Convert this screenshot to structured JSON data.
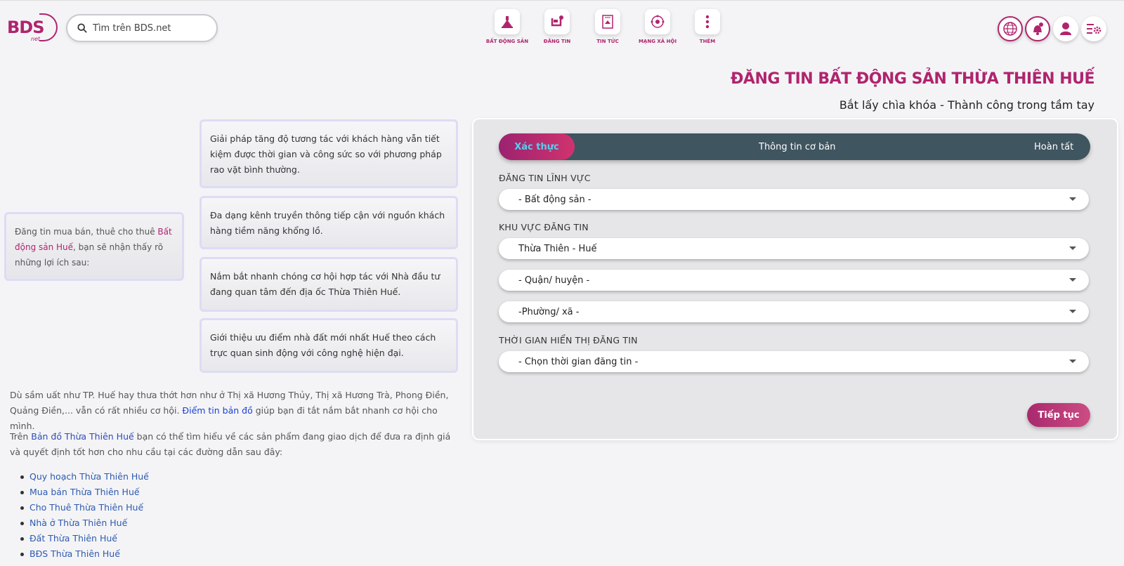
{
  "brand": {
    "logo_text": "BDS",
    "logo_sub": "net",
    "accent": "#b0246e"
  },
  "search": {
    "placeholder": "Tìm trên BDS.net"
  },
  "nav": [
    {
      "label": "BẤT ĐỘNG SẢN",
      "icon": "house-icon"
    },
    {
      "label": "ĐĂNG TIN",
      "icon": "post-icon"
    },
    {
      "label": "TIN TỨC",
      "icon": "news-icon"
    },
    {
      "label": "MẠNG XÃ HỘI",
      "icon": "social-icon"
    },
    {
      "label": "THÊM",
      "icon": "more-icon"
    }
  ],
  "header_icons": [
    "globe-icon",
    "bell-icon",
    "user-icon",
    "settings-icon"
  ],
  "page": {
    "title": "ĐĂNG TIN BẤT ĐỘNG SẢN THỪA THIÊN HUẾ",
    "subtitle": "Bắt lấy chìa khóa - Thành công trong tầm tay"
  },
  "intro": {
    "text_before": "Đăng tin mua bán, thuê cho thuê ",
    "highlight": "Bất động sản Huế",
    "text_after": ", bạn sẽ nhận thấy rõ những lợi ích sau:"
  },
  "benefits": [
    "Giải pháp tăng độ tương tác với khách hàng vẫn tiết kiệm được thời gian và công sức so với phương pháp rao vặt bình thường.",
    "Đa dạng kênh truyền thông tiếp cận với nguồn khách hàng tiềm năng khổng lồ.",
    "Nắm bắt nhanh chóng cơ hội hợp tác với Nhà đầu tư đang quan tâm đến địa ốc Thừa Thiên Huế.",
    "Giới thiệu ưu điểm nhà đất mới nhất Huế theo cách trực quan sinh động với công nghệ hiện đại."
  ],
  "para1": {
    "text": "Dù sầm uất như TP. Huế hay thưa thớt hơn như ở Thị xã Hương Thủy, Thị xã Hương Trà, Phong Điền, Quảng Điền,... vẫn có rất nhiều cơ hội. ",
    "link": "Điểm tin bản đồ",
    "text_after": " giúp bạn đi tắt nắm bắt nhanh cơ hội cho mình."
  },
  "para2": {
    "text_before": "Trên ",
    "link": "Bản đồ Thừa Thiên Huế",
    "text_after": " bạn có thể tìm hiểu về các sản phẩm đang giao dịch để đưa ra định giá và quyết định tốt hơn cho nhu cầu tại các đường dẫn sau đây:"
  },
  "links": [
    "Quy hoạch Thừa Thiên Huế",
    "Mua bán Thừa Thiên Huế",
    "Cho Thuê Thừa Thiên Huế",
    "Nhà ở Thừa Thiên Huế",
    "Đất Thừa Thiên Huế",
    "BĐS Thừa Thiên Huế"
  ],
  "form": {
    "steps": {
      "active": "Xác thực",
      "middle": "Thông tin cơ bản",
      "last": "Hoàn tất"
    },
    "section_field": "ĐĂNG TIN LĨNH VỰC",
    "field_value": "- Bất động sản -",
    "section_area": "KHU VỰC ĐĂNG TIN",
    "province_value": "Thừa Thiên - Huế",
    "district_value": "- Quận/ huyện -",
    "ward_value": "-Phường/ xã -",
    "section_time": "THỜI GIAN HIỂN THỊ ĐĂNG TIN",
    "time_value": "- Chọn thời gian đăng tin -",
    "next_label": "Tiếp tục"
  }
}
